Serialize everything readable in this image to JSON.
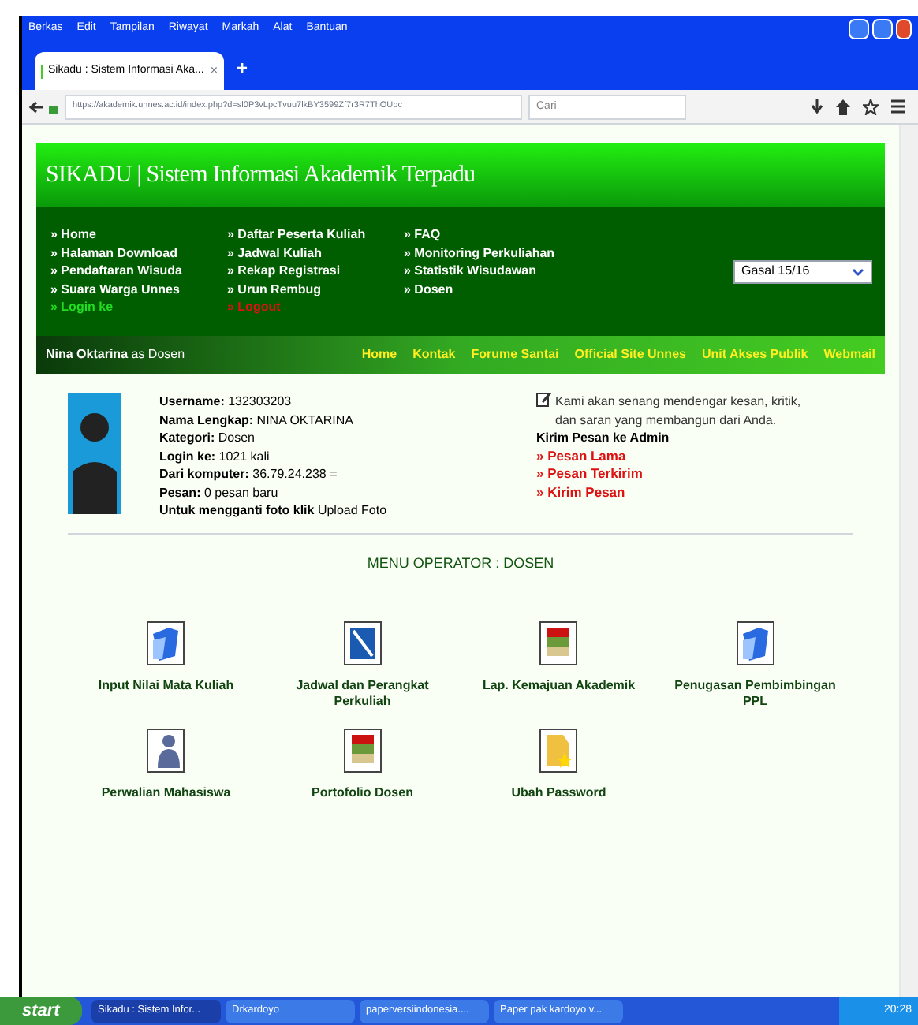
{
  "menu_bar": [
    "Berkas",
    "Edit",
    "Tampilan",
    "Riwayat",
    "Markah",
    "Alat",
    "Bantuan"
  ],
  "tab": {
    "title": "Sikadu : Sistem Informasi Aka...",
    "close": "×",
    "new_tab": "+"
  },
  "address_bar": {
    "url": "https://akademik.unnes.ac.id/index.php?d=sl0P3vLpcTvuu7lkBY3599Zf7r3R7ThOUbc"
  },
  "search": {
    "placeholder": "Cari"
  },
  "header": {
    "title": "SIKADU | Sistem Informasi Akademik Terpadu"
  },
  "nav_columns": [
    [
      {
        "label": "» Home",
        "kind": "normal"
      },
      {
        "label": "» Halaman Download",
        "kind": "normal"
      },
      {
        "label": "» Pendaftaran Wisuda",
        "kind": "normal"
      },
      {
        "label": "» Suara Warga Unnes",
        "kind": "normal"
      },
      {
        "label": "» Login ke",
        "kind": "login"
      }
    ],
    [
      {
        "label": "» Daftar Peserta Kuliah",
        "kind": "normal"
      },
      {
        "label": "» Jadwal Kuliah",
        "kind": "normal"
      },
      {
        "label": "» Rekap Registrasi",
        "kind": "normal"
      },
      {
        "label": "» Urun Rembug",
        "kind": "normal"
      },
      {
        "label": "» Logout",
        "kind": "logout"
      }
    ],
    [
      {
        "label": "» FAQ",
        "kind": "normal"
      },
      {
        "label": "» Monitoring Perkuliahan",
        "kind": "normal"
      },
      {
        "label": "» Statistik Wisudawan",
        "kind": "normal"
      },
      {
        "label": "» Dosen",
        "kind": "normal"
      }
    ]
  ],
  "semester_select": {
    "value": "Gasal 15/16"
  },
  "user_bar": {
    "name": "Nina Oktarina",
    "role": "as Dosen",
    "links": [
      "Home",
      "Kontak",
      "Forume Santai",
      "Official Site Unnes",
      "Unit Akses Publik",
      "Webmail"
    ]
  },
  "profile": {
    "fields": [
      {
        "label": "Username:",
        "value": "132303203"
      },
      {
        "label": "Nama Lengkap:",
        "value": "NINA OKTARINA"
      },
      {
        "label": "Kategori:",
        "value": "Dosen"
      },
      {
        "label": "Login ke:",
        "value": "1021 kali"
      },
      {
        "label": "Dari komputer:",
        "value": "36.79.24.238 ="
      },
      {
        "label": "Pesan:",
        "value": "0 pesan baru"
      }
    ],
    "photo_hint": "Untuk mengganti foto klik",
    "upload_link": "Upload Foto"
  },
  "feedback": {
    "text": "Kami akan senang mendengar kesan, kritik, dan saran yang membangun dari Anda.",
    "heading": "Kirim Pesan ke Admin",
    "links": [
      "» Pesan Lama",
      "» Pesan Terkirim",
      "» Kirim Pesan"
    ]
  },
  "menu": {
    "title": "MENU OPERATOR : DOSEN",
    "items": [
      {
        "label": "Input Nilai Mata Kuliah",
        "kind": "folder"
      },
      {
        "label": "Jadwal dan Perangkat Perkuliah",
        "kind": "document"
      },
      {
        "label": "Lap. Kemajuan Akademik",
        "kind": "books"
      },
      {
        "label": "Penugasan Pembimbingan PPL",
        "kind": "folder"
      },
      {
        "label": "Perwalian Mahasiswa",
        "kind": "person"
      },
      {
        "label": "Portofolio Dosen",
        "kind": "books"
      },
      {
        "label": "Ubah Password",
        "kind": "key"
      }
    ]
  },
  "taskbar": {
    "start": "start",
    "tasks": [
      {
        "label": "Sikadu : Sistem Infor...",
        "selected": true
      },
      {
        "label": "Drkardoyo",
        "selected": false
      },
      {
        "label": "paperversiindonesia....",
        "selected": false
      },
      {
        "label": "Paper pak kardoyo v...",
        "selected": false
      }
    ],
    "clock": "20:28"
  }
}
